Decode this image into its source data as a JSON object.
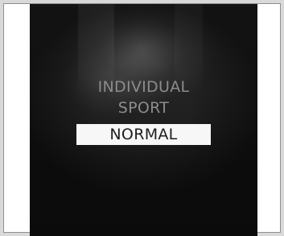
{
  "drive_mode_menu": {
    "items": [
      {
        "label": "INDIVIDUAL"
      },
      {
        "label": "SPORT"
      },
      {
        "label": "NORMAL",
        "selected": true
      }
    ]
  },
  "colors": {
    "screen_background": "#1a1a1a",
    "unselected_text": "#8c8c8c",
    "selected_highlight": "#f7f7f7",
    "selected_text": "#1e1e1e"
  }
}
